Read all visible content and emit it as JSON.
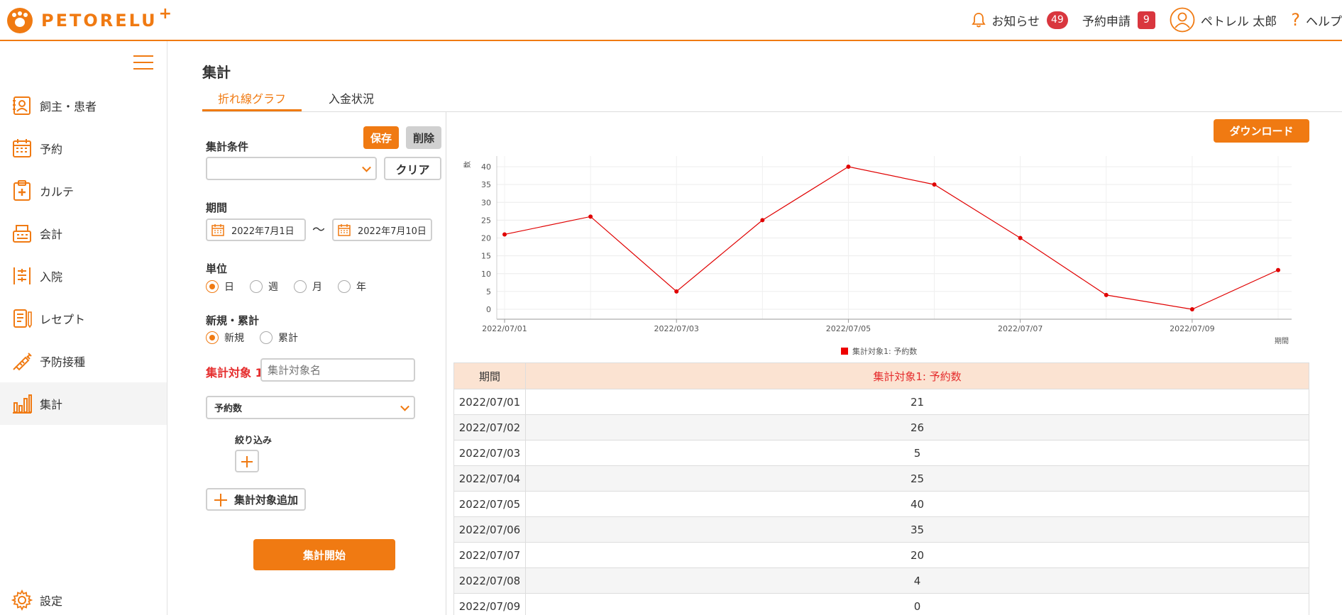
{
  "header": {
    "logo_text": "PETORELU",
    "logo_plus": "+",
    "notifications_label": "お知らせ",
    "notifications_count": "49",
    "reservations_label": "予約申請",
    "reservations_count": "9",
    "user_name": "ペトレル 太郎",
    "help_label": "ヘルプ"
  },
  "sidebar": {
    "items": [
      {
        "label": "飼主・患者",
        "icon": "owner-patient-icon"
      },
      {
        "label": "予約",
        "icon": "calendar-icon"
      },
      {
        "label": "カルテ",
        "icon": "medical-chart-icon"
      },
      {
        "label": "会計",
        "icon": "register-icon"
      },
      {
        "label": "入院",
        "icon": "hospitalization-icon"
      },
      {
        "label": "レセプト",
        "icon": "receipt-icon"
      },
      {
        "label": "予防接種",
        "icon": "syringe-icon"
      },
      {
        "label": "集計",
        "icon": "bar-chart-icon"
      }
    ],
    "settings_label": "設定"
  },
  "main": {
    "title": "集計",
    "tabs": [
      {
        "label": "折れ線グラフ",
        "active": true
      },
      {
        "label": "入金状況",
        "active": false
      }
    ]
  },
  "form": {
    "save_label": "保存",
    "delete_label": "削除",
    "condition_label": "集計条件",
    "condition_value": "",
    "clear_label": "クリア",
    "period_label": "期間",
    "date_from": "2022年7月1日",
    "date_to": "2022年7月10日",
    "tilde": "〜",
    "unit_label": "単位",
    "unit_options": [
      "日",
      "週",
      "月",
      "年"
    ],
    "unit_selected": "日",
    "mode_label": "新規・累計",
    "mode_options": [
      "新規",
      "累計"
    ],
    "mode_selected": "新規",
    "target_label": "集計対象 1",
    "target_name_placeholder": "集計対象名",
    "target_metric": "予約数",
    "filter_label": "絞り込み",
    "add_target_label": "集計対象追加",
    "start_label": "集計開始"
  },
  "download_label": "ダウンロード",
  "chart_data": {
    "type": "line",
    "ylabel": "数",
    "xlabel": "期間",
    "x": [
      "2022/07/01",
      "2022/07/02",
      "2022/07/03",
      "2022/07/04",
      "2022/07/05",
      "2022/07/06",
      "2022/07/07",
      "2022/07/08",
      "2022/07/09",
      "2022/07/10"
    ],
    "x_tick_labels": [
      "2022/07/01",
      "2022/07/03",
      "2022/07/05",
      "2022/07/07",
      "2022/07/09"
    ],
    "y_ticks": [
      0,
      5,
      10,
      15,
      20,
      25,
      30,
      35,
      40
    ],
    "ylim": [
      0,
      40
    ],
    "series": [
      {
        "name": "集計対象1: 予約数",
        "values": [
          21,
          26,
          5,
          25,
          40,
          35,
          20,
          4,
          0,
          11
        ],
        "color": "#e00000"
      }
    ],
    "grid": true,
    "legend_position": "bottom"
  },
  "table": {
    "headers": [
      "期間",
      "集計対象1: 予約数"
    ],
    "rows": [
      [
        "2022/07/01",
        "21"
      ],
      [
        "2022/07/02",
        "26"
      ],
      [
        "2022/07/03",
        "5"
      ],
      [
        "2022/07/04",
        "25"
      ],
      [
        "2022/07/05",
        "40"
      ],
      [
        "2022/07/06",
        "35"
      ],
      [
        "2022/07/07",
        "20"
      ],
      [
        "2022/07/08",
        "4"
      ],
      [
        "2022/07/09",
        "0"
      ]
    ]
  },
  "colors": {
    "accent": "#f07a12",
    "badge": "#d9363e",
    "series": "#e00000",
    "header_row": "#fbe3d2"
  }
}
